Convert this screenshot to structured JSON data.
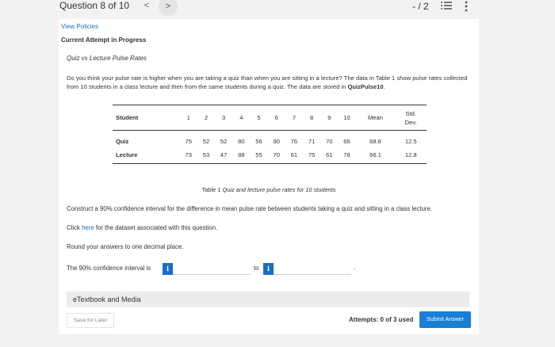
{
  "header": {
    "question_counter": "Question 8 of 10",
    "prev_glyph": "<",
    "next_glyph": ">",
    "score": "- / 2"
  },
  "card": {
    "view_policies": "View Policies",
    "attempt_status": "Current Attempt in Progress"
  },
  "question": {
    "title": "Quiz vs Lecture Pulse Rates",
    "text_before": "Do you think your pulse rate is higher when you are taking a quiz than when you are sitting in a lecture? The data in Table 1 show pulse rates collected from 10 students in a class lecture and then from the same students during a quiz. The data are stored in ",
    "dataset_name": "QuizPulse10",
    "text_after": "."
  },
  "table": {
    "headers": [
      "Student",
      "1",
      "2",
      "3",
      "4",
      "5",
      "6",
      "7",
      "8",
      "9",
      "10",
      "Mean",
      "Std. Dev."
    ],
    "std_dev_line1": "Std.",
    "std_dev_line2": "Dev.",
    "rows": [
      {
        "label": "Quiz",
        "values": [
          "75",
          "52",
          "52",
          "80",
          "56",
          "90",
          "76",
          "71",
          "70",
          "66",
          "68.8",
          "12.5"
        ]
      },
      {
        "label": "Lecture",
        "values": [
          "73",
          "53",
          "47",
          "88",
          "55",
          "70",
          "61",
          "75",
          "61",
          "78",
          "66.1",
          "12.8"
        ]
      }
    ],
    "caption_prefix": "Table 1 ",
    "caption_italic": "Quiz and lecture pulse rates for 10 students"
  },
  "instructions": {
    "construct": "Construct a 90% confidence interval for the difference in mean pulse rate between students taking a quiz and sitting in a class lecture.",
    "click_prefix": "Click ",
    "click_link": "here",
    "click_suffix": " for the dataset associated with this question.",
    "round": "Round your answers to one decimal place."
  },
  "answer": {
    "label": "The 90% confidence interval is",
    "info_glyph": "i",
    "lower_value": "",
    "upper_value": "",
    "to_label": "to",
    "period": "."
  },
  "etextbook": {
    "label": "eTextbook and Media"
  },
  "footer": {
    "save_later": "Save for Later",
    "attempts": "Attempts: 0 of 3 used",
    "submit": "Submit Answer"
  },
  "colors": {
    "accent": "#1a6fc4",
    "submit": "#1a7fd6",
    "background": "#f2f2f2"
  },
  "icons": {
    "prev": "chevron-left-icon",
    "next": "chevron-right-icon",
    "list": "list-icon",
    "more": "more-vertical-icon",
    "info": "info-icon"
  }
}
